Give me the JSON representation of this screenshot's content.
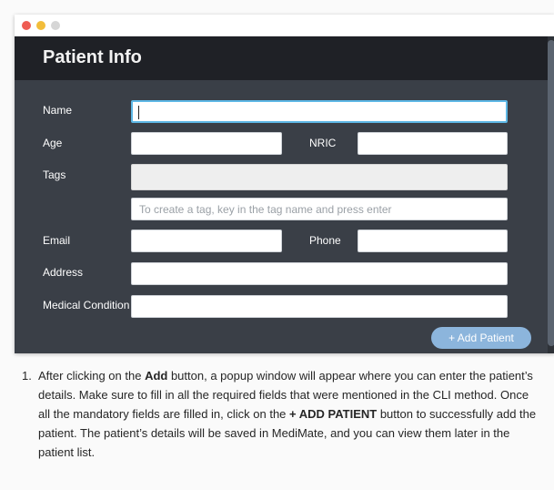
{
  "window": {
    "title": "Patient Info"
  },
  "form": {
    "name_label": "Name",
    "name_value": "",
    "age_label": "Age",
    "age_value": "",
    "nric_label": "NRIC",
    "nric_value": "",
    "tags_label": "Tags",
    "tags_input_placeholder": "To create a tag, key in the tag name and press enter",
    "email_label": "Email",
    "email_value": "",
    "phone_label": "Phone",
    "phone_value": "",
    "address_label": "Address",
    "address_value": "",
    "medical_label": "Medical Condition",
    "medical_value": "",
    "add_button_label": "+ Add Patient"
  },
  "instructions": {
    "number": "1.",
    "part1": "After clicking on the ",
    "bold1": "Add",
    "part2": " button, a popup window will appear where you can enter the patient’s details. Make sure to fill in all the required fields that were mentioned in the CLI method. Once all the mandatory fields are filled in, click on the ",
    "bold2": "+ ADD PATIENT",
    "part3": " button to successfully add the patient. The patient’s details will be saved in MediMate, and you can view them later in the patient list."
  }
}
